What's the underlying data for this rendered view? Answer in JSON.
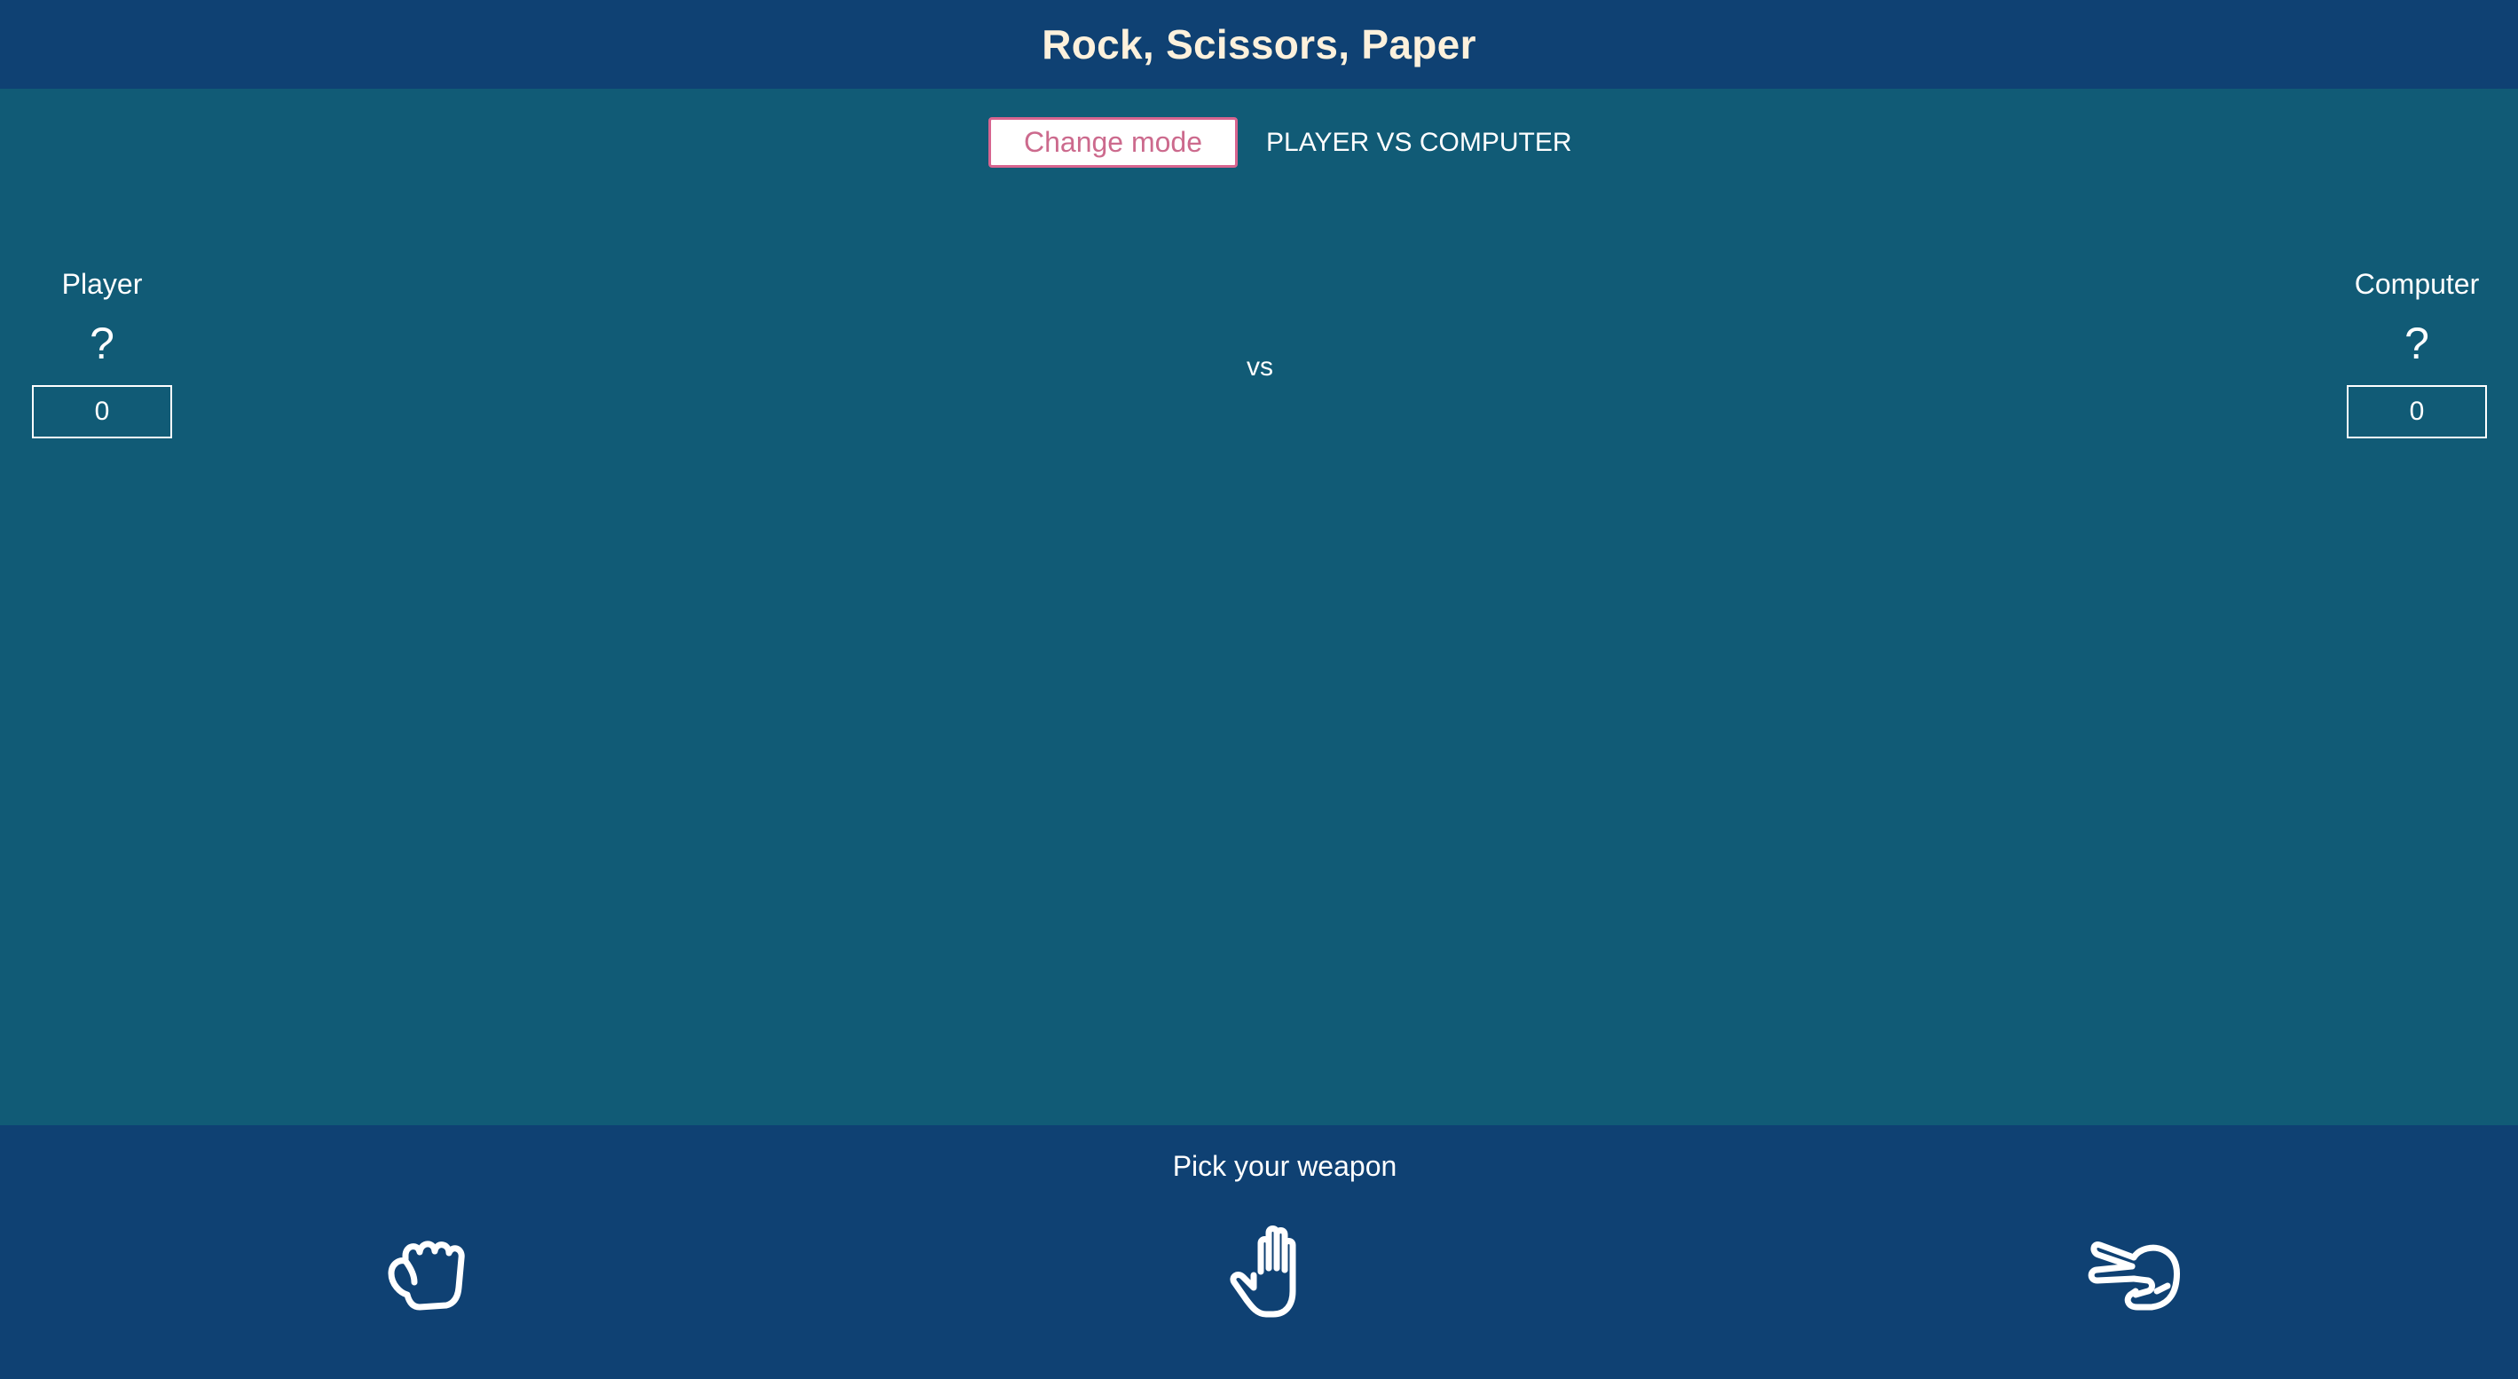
{
  "header": {
    "title": "Rock, Scissors, Paper"
  },
  "mode": {
    "button_label": "Change mode",
    "current_mode": "PLAYER VS COMPUTER"
  },
  "player": {
    "name": "Player",
    "choice": "?",
    "score": "0"
  },
  "computer": {
    "name": "Computer",
    "choice": "?",
    "score": "0"
  },
  "vs_label": "vs",
  "footer": {
    "prompt": "Pick your weapon",
    "weapons": [
      {
        "icon": "rock-hand-icon"
      },
      {
        "icon": "paper-hand-icon"
      },
      {
        "icon": "scissors-hand-icon"
      }
    ]
  },
  "colors": {
    "header_bg": "#0f4173",
    "main_bg": "#115b76",
    "title_text": "#fdf1dc",
    "accent_pink": "#d7648f"
  }
}
